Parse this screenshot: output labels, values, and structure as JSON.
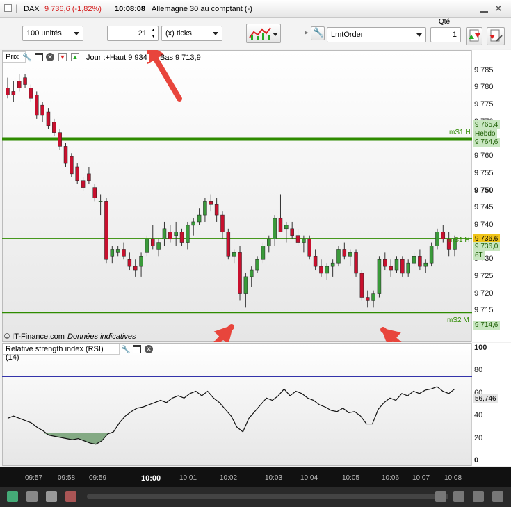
{
  "titlebar": {
    "instrument": "DAX",
    "price_change": "9 736,6 (-1,82%)",
    "time": "10:08:08",
    "market": "Allemagne 30 au comptant (-)"
  },
  "toolbar": {
    "units_select": "100 unités",
    "ticks_value": "21",
    "ticks_select": "(x) ticks",
    "order_type": "LmtOrder",
    "qty_label": "Qté",
    "qty_value": "1"
  },
  "price_panel": {
    "label": "Prix",
    "day_info": "Jour :+Haut 9 934",
    "day_low": "Bas 9 713,9",
    "copyright": "© IT-Finance.com",
    "data_note": "Données indicatives",
    "ticks": [
      "9 785",
      "9 780",
      "9 775",
      "9 770",
      "9 765",
      "9 760",
      "9 755",
      "9 750",
      "9 745",
      "9 740",
      "9 735",
      "9 730",
      "9 725",
      "9 720",
      "9 715"
    ],
    "line_labels": {
      "ms1_hebdo": "mS1 H",
      "ms1_h": "mS1 H",
      "ms2": "mS2 M"
    },
    "tags": {
      "ms1_val": "9 765,4",
      "hebdo": "Hebdo",
      "ms1_val2": "9 764,6",
      "current": "9 736,6",
      "ms1h_val": "9 736,0",
      "et": "6T",
      "ms2_val": "9 714,6"
    }
  },
  "rsi_panel": {
    "label": "Relative strength index (RSI) (14)",
    "ticks": [
      "100",
      "80",
      "60",
      "40",
      "20",
      "0"
    ],
    "current": "56,746"
  },
  "time_axis": [
    "09:57",
    "09:58",
    "09:59",
    "10:00",
    "10:01",
    "10:02",
    "10:03",
    "10:04",
    "10:05",
    "10:06",
    "10:07",
    "10:08"
  ],
  "colors": {
    "up": "#3a9a3a",
    "down": "#c8102e",
    "support": "#2e8b00",
    "rsi_line": "#3333aa",
    "arrow": "#e8453c"
  },
  "chart_data": {
    "type": "candlestick",
    "ylim": [
      9711,
      9788
    ],
    "candles": [
      [
        9780,
        9783,
        9777,
        9778
      ],
      [
        9779,
        9782,
        9776,
        9778
      ],
      [
        9782,
        9784,
        9779,
        9780
      ],
      [
        9783,
        9784,
        9780,
        9781
      ],
      [
        9780,
        9781,
        9776,
        9777
      ],
      [
        9778,
        9779,
        9771,
        9772
      ],
      [
        9775,
        9776,
        9770,
        9772
      ],
      [
        9773,
        9774,
        9768,
        9769
      ],
      [
        9770,
        9771,
        9766,
        9767
      ],
      [
        9767,
        9768,
        9762,
        9763
      ],
      [
        9763,
        9764,
        9757,
        9758
      ],
      [
        9760,
        9761,
        9754,
        9755
      ],
      [
        9757,
        9758,
        9752,
        9753
      ],
      [
        9753,
        9754,
        9750,
        9751
      ],
      [
        9755,
        9757,
        9752,
        9753
      ],
      [
        9751,
        9752,
        9747,
        9748
      ],
      [
        9747,
        9749,
        9743,
        9747
      ],
      [
        9747,
        9748,
        9729,
        9730
      ],
      [
        9731,
        9734,
        9729,
        9733
      ],
      [
        9732,
        9734,
        9731,
        9733
      ],
      [
        9733,
        9735,
        9730,
        9731
      ],
      [
        9730,
        9732,
        9727,
        9728
      ],
      [
        9728,
        9730,
        9725,
        9727
      ],
      [
        9728,
        9732,
        9725,
        9731
      ],
      [
        9732,
        9737,
        9731,
        9736
      ],
      [
        9736,
        9740,
        9733,
        9734
      ],
      [
        9733,
        9736,
        9731,
        9735
      ],
      [
        9736,
        9741,
        9734,
        9739
      ],
      [
        9738,
        9740,
        9735,
        9736
      ],
      [
        9737,
        9741,
        9734,
        9738
      ],
      [
        9738,
        9739,
        9734,
        9735
      ],
      [
        9735,
        9741,
        9733,
        9740
      ],
      [
        9740,
        9742,
        9737,
        9741
      ],
      [
        9741,
        9745,
        9740,
        9743
      ],
      [
        9743,
        9748,
        9741,
        9747
      ],
      [
        9747,
        9749,
        9744,
        9746
      ],
      [
        9746,
        9748,
        9741,
        9743
      ],
      [
        9743,
        9744,
        9736,
        9738
      ],
      [
        9738,
        9739,
        9730,
        9731
      ],
      [
        9731,
        9733,
        9729,
        9732
      ],
      [
        9732,
        9734,
        9718,
        9720
      ],
      [
        9720,
        9726,
        9716,
        9725
      ],
      [
        9725,
        9728,
        9722,
        9727
      ],
      [
        9727,
        9731,
        9726,
        9730
      ],
      [
        9730,
        9735,
        9729,
        9734
      ],
      [
        9734,
        9737,
        9732,
        9736
      ],
      [
        9736,
        9743,
        9734,
        9742
      ],
      [
        9742,
        9749,
        9740,
        9738
      ],
      [
        9739,
        9741,
        9735,
        9740
      ],
      [
        9739,
        9741,
        9736,
        9737
      ],
      [
        9737,
        9739,
        9734,
        9735
      ],
      [
        9735,
        9737,
        9732,
        9736
      ],
      [
        9736,
        9737,
        9730,
        9731
      ],
      [
        9731,
        9733,
        9727,
        9728
      ],
      [
        9728,
        9730,
        9725,
        9726
      ],
      [
        9726,
        9729,
        9724,
        9728
      ],
      [
        9728,
        9730,
        9725,
        9729
      ],
      [
        9729,
        9734,
        9728,
        9733
      ],
      [
        9733,
        9735,
        9730,
        9731
      ],
      [
        9731,
        9733,
        9728,
        9732
      ],
      [
        9732,
        9733,
        9725,
        9726
      ],
      [
        9726,
        9727,
        9718,
        9719
      ],
      [
        9719,
        9721,
        9716,
        9718
      ],
      [
        9718,
        9721,
        9716,
        9720
      ],
      [
        9720,
        9731,
        9719,
        9730
      ],
      [
        9730,
        9732,
        9727,
        9728
      ],
      [
        9728,
        9730,
        9725,
        9727
      ],
      [
        9727,
        9731,
        9726,
        9730
      ],
      [
        9730,
        9731,
        9725,
        9726
      ],
      [
        9726,
        9730,
        9725,
        9729
      ],
      [
        9729,
        9732,
        9728,
        9731
      ],
      [
        9731,
        9733,
        9727,
        9728
      ],
      [
        9728,
        9730,
        9726,
        9729
      ],
      [
        9729,
        9735,
        9728,
        9734
      ],
      [
        9734,
        9739,
        9733,
        9738
      ],
      [
        9738,
        9740,
        9735,
        9736
      ],
      [
        9736,
        9738,
        9731,
        9733
      ],
      [
        9733,
        9737,
        9731,
        9736
      ]
    ],
    "levels": [
      9765.0,
      9736.6,
      9714.6
    ],
    "rsi": [
      38,
      40,
      38,
      36,
      34,
      30,
      27,
      23,
      22,
      21,
      20,
      19,
      20,
      18,
      16,
      15,
      18,
      24,
      26,
      34,
      40,
      44,
      47,
      48,
      50,
      52,
      54,
      52,
      56,
      58,
      56,
      60,
      62,
      58,
      62,
      56,
      52,
      46,
      40,
      30,
      26,
      38,
      44,
      50,
      56,
      54,
      58,
      64,
      58,
      62,
      60,
      56,
      54,
      50,
      48,
      45,
      44,
      47,
      43,
      44,
      40,
      33,
      33,
      46,
      52,
      56,
      54,
      60,
      58,
      62,
      60,
      63,
      64,
      66,
      62,
      60,
      64
    ]
  }
}
